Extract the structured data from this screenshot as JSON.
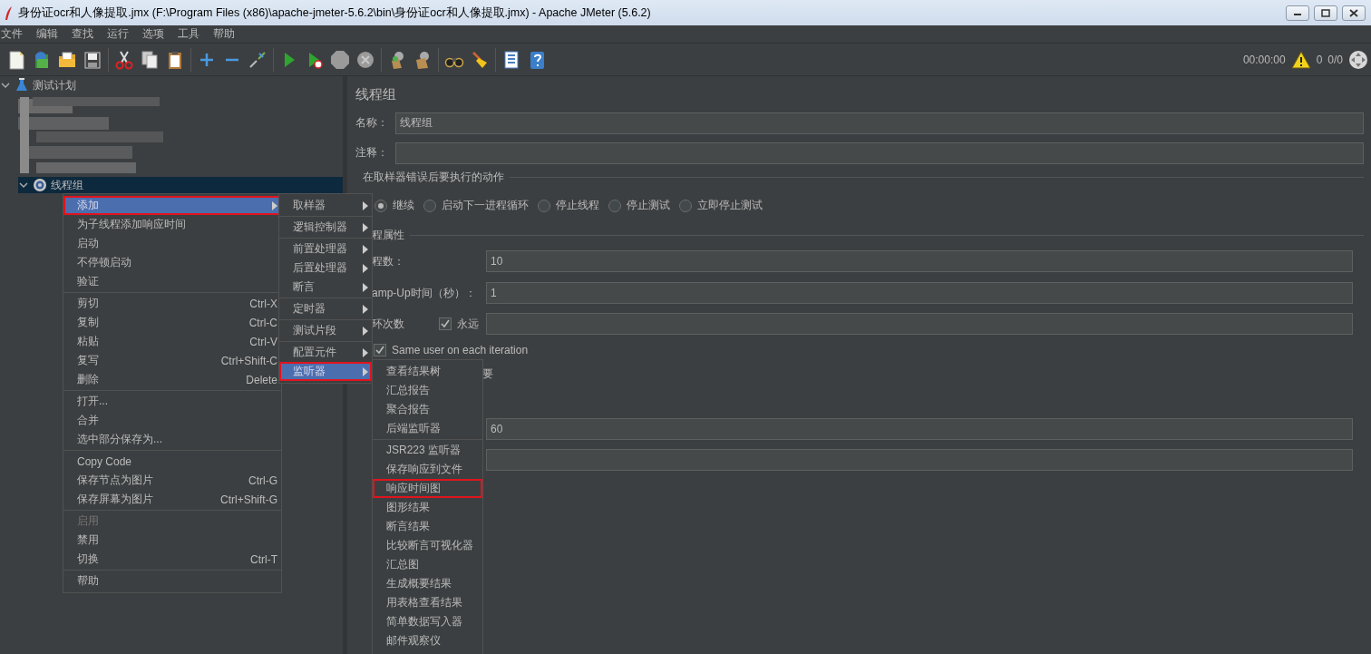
{
  "window": {
    "title": "身份证ocr和人像提取.jmx (F:\\Program Files (x86)\\apache-jmeter-5.6.2\\bin\\身份证ocr和人像提取.jmx) - Apache JMeter (5.6.2)"
  },
  "menu_bar": [
    "文件",
    "编辑",
    "查找",
    "运行",
    "选项",
    "工具",
    "帮助"
  ],
  "toolbar": {
    "timer": "00:00:00",
    "error_count": "0",
    "threads": "0/0"
  },
  "tree": {
    "items": [
      {
        "kind": "plan",
        "label": "测试计划",
        "expanded": true,
        "selected": false,
        "children": [
          {
            "kind": "thread_group",
            "label": "线程组",
            "expanded": true,
            "selected": true
          }
        ]
      }
    ]
  },
  "panel": {
    "title": "线程组",
    "name_label": "名称：",
    "name_value": "线程组",
    "comment_label": "注释：",
    "error_action": {
      "title": "在取样器错误后要执行的动作",
      "options": [
        {
          "label": "继续",
          "selected": true
        },
        {
          "label": "启动下一进程循环",
          "selected": false
        },
        {
          "label": "停止线程",
          "selected": false
        },
        {
          "label": "停止测试",
          "selected": false
        },
        {
          "label": "立即停止测试",
          "selected": false
        }
      ]
    },
    "thread_properties": {
      "title": "程属性",
      "rows": [
        {
          "kind": "field",
          "label": "程数：",
          "value": "10"
        },
        {
          "kind": "field",
          "label": "amp-Up时间（秒）：",
          "value": "1"
        },
        {
          "kind": "loop",
          "label": "环次数",
          "option": "永远",
          "checked": true
        },
        {
          "kind": "checkbox",
          "label": "Same user on each iteration",
          "checked": true
        },
        {
          "kind": "text",
          "label": "要"
        },
        {
          "kind": "field",
          "value": "60"
        },
        {
          "kind": "field"
        }
      ]
    }
  },
  "context_menu": {
    "items": [
      {
        "kind": "item",
        "label": "添加",
        "submenu": true,
        "selected": true,
        "marked": true,
        "disabled": false
      },
      {
        "kind": "item",
        "label": "为子线程添加响应时间",
        "submenu": false,
        "selected": false,
        "marked": false,
        "disabled": false
      },
      {
        "kind": "item",
        "label": "启动",
        "submenu": false,
        "selected": false,
        "marked": false,
        "disabled": false
      },
      {
        "kind": "item",
        "label": "不停顿启动",
        "submenu": false,
        "selected": false,
        "marked": false,
        "disabled": false
      },
      {
        "kind": "item",
        "label": "验证",
        "submenu": false,
        "selected": false,
        "marked": false,
        "disabled": false
      },
      {
        "kind": "separator"
      },
      {
        "kind": "item",
        "label": "剪切",
        "shortcut": "Ctrl-X",
        "submenu": false,
        "selected": false,
        "marked": false,
        "disabled": false
      },
      {
        "kind": "item",
        "label": "复制",
        "shortcut": "Ctrl-C",
        "submenu": false,
        "selected": false,
        "marked": false,
        "disabled": false
      },
      {
        "kind": "item",
        "label": "粘贴",
        "shortcut": "Ctrl-V",
        "submenu": false,
        "selected": false,
        "marked": false,
        "disabled": false
      },
      {
        "kind": "item",
        "label": "复写",
        "shortcut": "Ctrl+Shift-C",
        "submenu": false,
        "selected": false,
        "marked": false,
        "disabled": false
      },
      {
        "kind": "item",
        "label": "删除",
        "shortcut": "Delete",
        "submenu": false,
        "selected": false,
        "marked": false,
        "disabled": false
      },
      {
        "kind": "separator"
      },
      {
        "kind": "item",
        "label": "打开...",
        "submenu": false,
        "selected": false,
        "marked": false,
        "disabled": false
      },
      {
        "kind": "item",
        "label": "合并",
        "submenu": false,
        "selected": false,
        "marked": false,
        "disabled": false
      },
      {
        "kind": "item",
        "label": "选中部分保存为...",
        "submenu": false,
        "selected": false,
        "marked": false,
        "disabled": false
      },
      {
        "kind": "separator"
      },
      {
        "kind": "item",
        "label": "Copy Code",
        "submenu": false,
        "selected": false,
        "marked": false,
        "disabled": false
      },
      {
        "kind": "item",
        "label": "保存节点为图片",
        "shortcut": "Ctrl-G",
        "submenu": false,
        "selected": false,
        "marked": false,
        "disabled": false
      },
      {
        "kind": "item",
        "label": "保存屏幕为图片",
        "shortcut": "Ctrl+Shift-G",
        "submenu": false,
        "selected": false,
        "marked": false,
        "disabled": false
      },
      {
        "kind": "separator"
      },
      {
        "kind": "item",
        "label": "启用",
        "submenu": false,
        "selected": false,
        "marked": false,
        "disabled": true
      },
      {
        "kind": "item",
        "label": "禁用",
        "submenu": false,
        "selected": false,
        "marked": false,
        "disabled": false
      },
      {
        "kind": "item",
        "label": "切换",
        "shortcut": "Ctrl-T",
        "submenu": false,
        "selected": false,
        "marked": false,
        "disabled": false
      },
      {
        "kind": "separator"
      },
      {
        "kind": "item",
        "label": "帮助",
        "submenu": false,
        "selected": false,
        "marked": false,
        "disabled": false
      }
    ]
  },
  "add_submenu": {
    "items": [
      {
        "kind": "item",
        "label": "取样器",
        "submenu": true,
        "selected": false,
        "marked": false
      },
      {
        "kind": "separator"
      },
      {
        "kind": "item",
        "label": "逻辑控制器",
        "submenu": true,
        "selected": false,
        "marked": false
      },
      {
        "kind": "separator"
      },
      {
        "kind": "item",
        "label": "前置处理器",
        "submenu": true,
        "selected": false,
        "marked": false
      },
      {
        "kind": "item",
        "label": "后置处理器",
        "submenu": true,
        "selected": false,
        "marked": false
      },
      {
        "kind": "item",
        "label": "断言",
        "submenu": true,
        "selected": false,
        "marked": false
      },
      {
        "kind": "separator"
      },
      {
        "kind": "item",
        "label": "定时器",
        "submenu": true,
        "selected": false,
        "marked": false
      },
      {
        "kind": "separator"
      },
      {
        "kind": "item",
        "label": "测试片段",
        "submenu": true,
        "selected": false,
        "marked": false
      },
      {
        "kind": "separator"
      },
      {
        "kind": "item",
        "label": "配置元件",
        "submenu": true,
        "selected": false,
        "marked": false
      },
      {
        "kind": "item",
        "label": "监听器",
        "submenu": true,
        "selected": true,
        "marked": true
      }
    ]
  },
  "listener_submenu": {
    "items": [
      {
        "kind": "item",
        "label": "查看结果树",
        "selected": false,
        "marked": false
      },
      {
        "kind": "item",
        "label": "汇总报告",
        "selected": false,
        "marked": false
      },
      {
        "kind": "item",
        "label": "聚合报告",
        "selected": false,
        "marked": false
      },
      {
        "kind": "item",
        "label": "后端监听器",
        "selected": false,
        "marked": false
      },
      {
        "kind": "separator"
      },
      {
        "kind": "item",
        "label": "JSR223 监听器",
        "selected": false,
        "marked": false
      },
      {
        "kind": "item",
        "label": "保存响应到文件",
        "selected": false,
        "marked": false
      },
      {
        "kind": "item",
        "label": "响应时间图",
        "selected": false,
        "marked": true
      },
      {
        "kind": "item",
        "label": "图形结果",
        "selected": false,
        "marked": false
      },
      {
        "kind": "item",
        "label": "断言结果",
        "selected": false,
        "marked": false
      },
      {
        "kind": "item",
        "label": "比较断言可视化器",
        "selected": false,
        "marked": false
      },
      {
        "kind": "item",
        "label": "汇总图",
        "selected": false,
        "marked": false
      },
      {
        "kind": "item",
        "label": "生成概要结果",
        "selected": false,
        "marked": false
      },
      {
        "kind": "item",
        "label": "用表格查看结果",
        "selected": false,
        "marked": false
      },
      {
        "kind": "item",
        "label": "简单数据写入器",
        "selected": false,
        "marked": false
      },
      {
        "kind": "item",
        "label": "邮件观察仪",
        "selected": false,
        "marked": false
      }
    ]
  }
}
